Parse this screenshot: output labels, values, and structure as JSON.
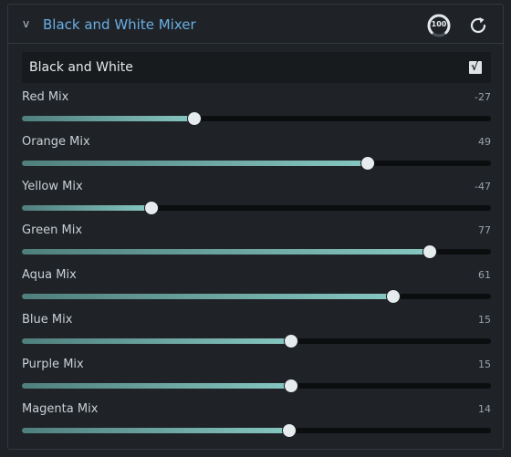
{
  "panel": {
    "collapse_glyph": "v",
    "title": "Black and White Mixer",
    "opacity_icon_text": "100",
    "icons": {
      "opacity": "opacity-gauge-icon",
      "reset": "reset-icon"
    }
  },
  "bw_toggle": {
    "label": "Black and White",
    "checked": true,
    "check_glyph": "√"
  },
  "sliders": [
    {
      "label": "Red Mix",
      "value": "-27",
      "fill": 0.368
    },
    {
      "label": "Orange Mix",
      "value": "49",
      "fill": 0.738
    },
    {
      "label": "Yellow Mix",
      "value": "-47",
      "fill": 0.276
    },
    {
      "label": "Green Mix",
      "value": "77",
      "fill": 0.87
    },
    {
      "label": "Aqua Mix",
      "value": "61",
      "fill": 0.792
    },
    {
      "label": "Blue Mix",
      "value": "15",
      "fill": 0.574
    },
    {
      "label": "Purple Mix",
      "value": "15",
      "fill": 0.574
    },
    {
      "label": "Magenta Mix",
      "value": "14",
      "fill": 0.57
    }
  ],
  "colors": {
    "accent": "#6aaee4",
    "slider_fill_start": "#4f7f7c",
    "slider_fill_end": "#86c7c1",
    "background": "#1f2327"
  }
}
